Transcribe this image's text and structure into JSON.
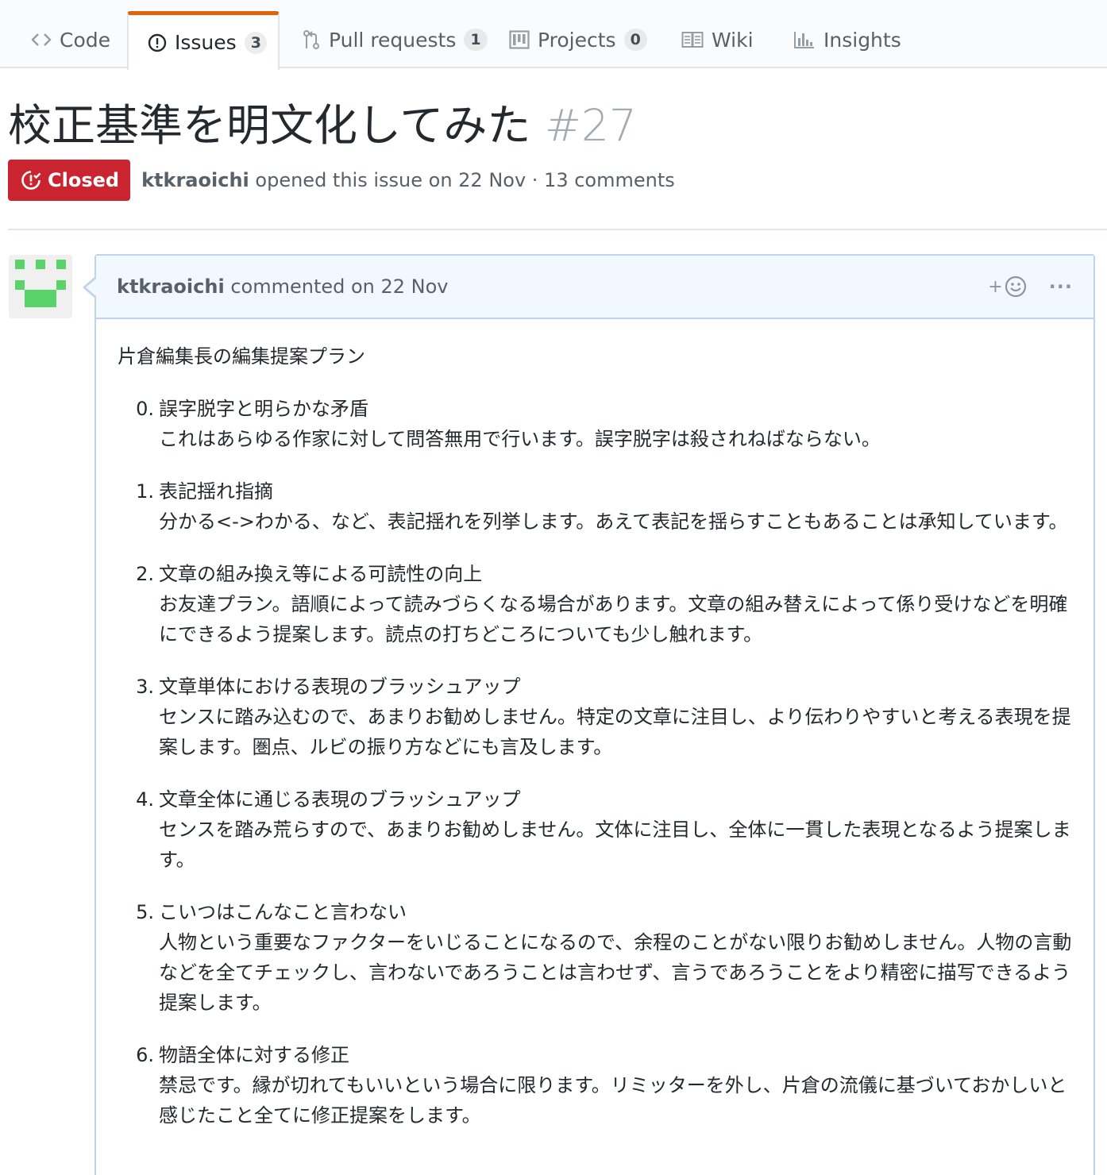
{
  "repo_nav": {
    "tabs": [
      {
        "label": "Code",
        "icon": "code-icon"
      },
      {
        "label": "Issues",
        "icon": "issue-opened-icon",
        "count": "3",
        "selected": true
      },
      {
        "label": "Pull requests",
        "icon": "git-pull-request-icon",
        "count": "1"
      },
      {
        "label": "Projects",
        "icon": "project-icon",
        "count": "0"
      },
      {
        "label": "Wiki",
        "icon": "book-icon"
      },
      {
        "label": "Insights",
        "icon": "graph-icon"
      }
    ],
    "selected_accent": "#e36209"
  },
  "issue": {
    "title": "校正基準を明文化してみた",
    "number": "#27",
    "state": "Closed",
    "state_color": "#cb2431",
    "author": "ktkraoichi",
    "meta_text": "opened this issue on 22 Nov · 13 comments"
  },
  "comment": {
    "author": "ktkraoichi",
    "meta_text": "commented on 22 Nov",
    "reaction_label": "+",
    "more_label": "···",
    "intro": "片倉編集長の編集提案プラン",
    "items": [
      {
        "num": "0.",
        "heading": "誤字脱字と明らかな矛盾",
        "desc": "これはあらゆる作家に対して問答無用で行います。誤字脱字は殺されねばならない。"
      },
      {
        "num": "1.",
        "heading": "表記揺れ指摘",
        "desc": "分かる<->わかる、など、表記揺れを列挙します。あえて表記を揺らすこともあることは承知しています。"
      },
      {
        "num": "2.",
        "heading": "文章の組み換え等による可読性の向上",
        "desc": "お友達プラン。語順によって読みづらくなる場合があります。文章の組み替えによって係り受けなどを明確にできるよう提案します。読点の打ちどころについても少し触れます。"
      },
      {
        "num": "3.",
        "heading": "文章単体における表現のブラッシュアップ",
        "desc": "センスに踏み込むので、あまりお勧めしません。特定の文章に注目し、より伝わりやすいと考える表現を提案します。圏点、ルビの振り方などにも言及します。"
      },
      {
        "num": "4.",
        "heading": "文章全体に通じる表現のブラッシュアップ",
        "desc": "センスを踏み荒らすので、あまりお勧めしません。文体に注目し、全体に一貫した表現となるよう提案します。"
      },
      {
        "num": "5.",
        "heading": "こいつはこんなこと言わない",
        "desc": "人物という重要なファクターをいじることになるので、余程のことがない限りお勧めしません。人物の言動などを全てチェックし、言わないであろうことは言わせず、言うであろうことをより精密に描写できるよう提案します。"
      },
      {
        "num": "6.",
        "heading": "物語全体に対する修正",
        "desc": "禁忌です。縁が切れてもいいという場合に限ります。リミッターを外し、片倉の流儀に基づいておかしいと感じたこと全てに修正提案をします。"
      }
    ]
  }
}
